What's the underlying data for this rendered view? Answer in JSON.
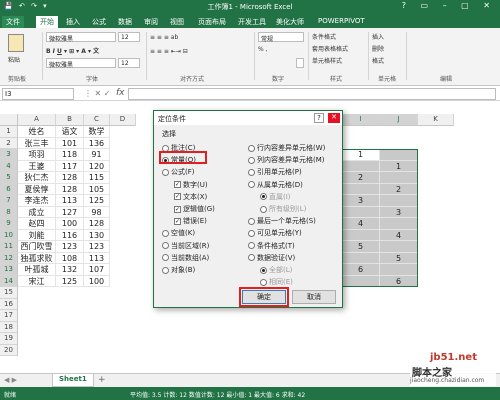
{
  "window": {
    "title": "工作簿1 - Microsoft Excel",
    "qat": "💾 ↶ ↷ ▾"
  },
  "tabs": [
    "文件",
    "开始",
    "插入",
    "公式",
    "数据",
    "审阅",
    "视图",
    "页面布局",
    "开发工具",
    "美化大师",
    "POWERPIVOT"
  ],
  "ribbon": {
    "font_name": "微软雅黑",
    "font_size": "12",
    "font_name2": "微软雅黑",
    "font_size2": "12",
    "number_format": "常规",
    "groups": [
      "剪贴板",
      "字体",
      "对齐方式",
      "数字",
      "样式",
      "单元格",
      "编辑"
    ],
    "cond_format": "条件格式",
    "table_format": "套用表格格式",
    "cell_style": "单元格样式",
    "insert": "插入",
    "delete": "删除",
    "format": "格式",
    "paste": "粘贴",
    "percent": "% ,"
  },
  "formula_bar": {
    "name_box": "I3",
    "fx": "fx"
  },
  "columns": [
    "A",
    "B",
    "C",
    "D",
    "I",
    "J",
    "K"
  ],
  "rows": [
    "1",
    "2",
    "3",
    "4",
    "5",
    "6",
    "7",
    "8",
    "9",
    "10",
    "11",
    "12",
    "13",
    "14",
    "15",
    "16",
    "17",
    "18",
    "19",
    "20"
  ],
  "table": {
    "header": [
      "姓名",
      "语文",
      "数学"
    ],
    "data": [
      [
        "张三丰",
        "101",
        "136"
      ],
      [
        "项羽",
        "118",
        "91"
      ],
      [
        "王婆",
        "117",
        "120"
      ],
      [
        "狄仁杰",
        "128",
        "115"
      ],
      [
        "夏侯惇",
        "128",
        "105"
      ],
      [
        "李连杰",
        "113",
        "125"
      ],
      [
        "成立",
        "127",
        "98"
      ],
      [
        "赵四",
        "100",
        "128"
      ],
      [
        "刘能",
        "116",
        "130"
      ],
      [
        "西门吹雪",
        "123",
        "123"
      ],
      [
        "独孤求败",
        "108",
        "113"
      ],
      [
        "叶孤城",
        "132",
        "107"
      ],
      [
        "宋江",
        "125",
        "100"
      ]
    ]
  },
  "col_i": [
    "1",
    "",
    "2",
    "",
    "3",
    "",
    "4",
    "",
    "5",
    "",
    "6",
    ""
  ],
  "col_j": [
    "",
    "1",
    "",
    "2",
    "",
    "3",
    "",
    "4",
    "",
    "5",
    "",
    "6"
  ],
  "dialog": {
    "title": "定位条件",
    "help": "?",
    "close": "✕",
    "section": "选择",
    "left_options": [
      {
        "label": "批注(C)",
        "type": "radio",
        "state": "off"
      },
      {
        "label": "常量(O)",
        "type": "radio",
        "state": "on"
      },
      {
        "label": "公式(F)",
        "type": "radio",
        "state": "off"
      },
      {
        "label": "数字(U)",
        "type": "check",
        "state": "on"
      },
      {
        "label": "文本(X)",
        "type": "check",
        "state": "on"
      },
      {
        "label": "逻辑值(G)",
        "type": "check",
        "state": "on"
      },
      {
        "label": "错误(E)",
        "type": "check",
        "state": "on"
      },
      {
        "label": "空值(K)",
        "type": "radio",
        "state": "off"
      },
      {
        "label": "当前区域(R)",
        "type": "radio",
        "state": "off"
      },
      {
        "label": "当前数组(A)",
        "type": "radio",
        "state": "off"
      },
      {
        "label": "对象(B)",
        "type": "radio",
        "state": "off"
      }
    ],
    "right_options": [
      {
        "label": "行内容差异单元格(W)",
        "type": "radio",
        "state": "off"
      },
      {
        "label": "列内容差异单元格(M)",
        "type": "radio",
        "state": "off"
      },
      {
        "label": "引用单元格(P)",
        "type": "radio",
        "state": "off"
      },
      {
        "label": "从属单元格(D)",
        "type": "radio",
        "state": "off"
      },
      {
        "label": "直属(I)",
        "type": "radio",
        "state": "on",
        "disabled": true
      },
      {
        "label": "所有级别(L)",
        "type": "radio",
        "state": "off",
        "disabled": true
      },
      {
        "label": "最后一个单元格(S)",
        "type": "radio",
        "state": "off"
      },
      {
        "label": "可见单元格(Y)",
        "type": "radio",
        "state": "off"
      },
      {
        "label": "条件格式(T)",
        "type": "radio",
        "state": "off"
      },
      {
        "label": "数据验证(V)",
        "type": "radio",
        "state": "off"
      },
      {
        "label": "全部(L)",
        "type": "radio",
        "state": "on",
        "disabled": true
      },
      {
        "label": "相同(E)",
        "type": "radio",
        "state": "off",
        "disabled": true
      }
    ],
    "ok": "确定",
    "cancel": "取消"
  },
  "sheet": {
    "tab": "Sheet1",
    "add": "+"
  },
  "status": {
    "ready": "就绪",
    "text": "平均值: 3.5    计数: 12    数值计数: 12    最小值: 1    最大值: 6    求和: 42"
  },
  "watermark": {
    "site": "jb51.net",
    "line": "脚本之家",
    "url": "jiaocheng.chazidian.com"
  },
  "colors": {
    "excel_green": "#217346",
    "highlight_red": "#e02020",
    "selection_gray": "#c9c9c9"
  }
}
